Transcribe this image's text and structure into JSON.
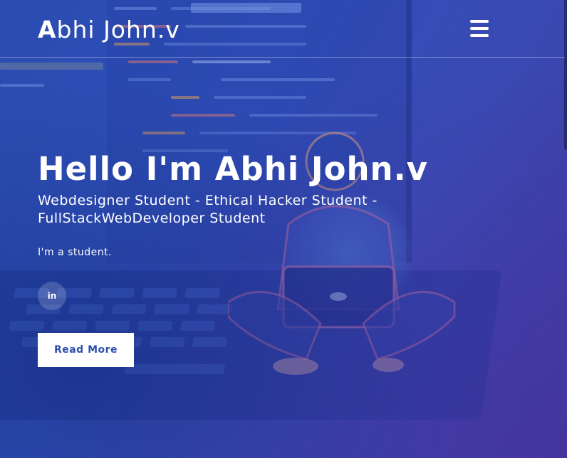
{
  "header": {
    "logo_first": "A",
    "logo_rest": "bhi John.v",
    "menu_icon": "hamburger-menu-icon"
  },
  "hero": {
    "title": "Hello I'm Abhi John.v",
    "subtitle": "Webdesigner Student - Ethical Hacker Student - FullStackWebDeveloper Student",
    "tagline": "I'm a student.",
    "social": {
      "icon": "linkedin-icon",
      "label": "in"
    },
    "button_label": "Read More"
  },
  "colors": {
    "background_start": "#2a4cb0",
    "background_end": "#41379c",
    "button_bg": "#ffffff",
    "button_text": "#2f4fb0"
  }
}
